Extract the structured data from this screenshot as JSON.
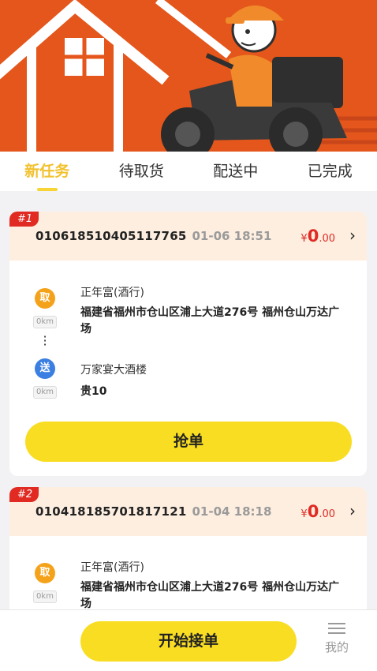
{
  "tabs": [
    "新任务",
    "待取货",
    "配送中",
    "已完成"
  ],
  "orders": [
    {
      "index": "#1",
      "order_no": "010618510405117765",
      "time": "01-06 18:51",
      "currency": "¥",
      "price_int": "0",
      "price_dec": ".00",
      "pickup": {
        "label": "取",
        "distance": "0km",
        "name": "正年富(酒行)",
        "addr_line1": "福建省福州市仓山区浦上大道276号 福州仓山万达广",
        "addr_line2": "场"
      },
      "dropoff": {
        "label": "送",
        "distance": "0km",
        "name": "万家宴大酒楼",
        "addr_line1": "贵10"
      },
      "button": "抢单"
    },
    {
      "index": "#2",
      "order_no": "010418185701817121",
      "time": "01-04 18:18",
      "currency": "¥",
      "price_int": "0",
      "price_dec": ".00",
      "pickup": {
        "label": "取",
        "distance": "0km",
        "name": "正年富(酒行)",
        "addr_line1": "福建省福州市仓山区浦上大道276号 福州仓山万达广",
        "addr_line2": "场"
      }
    }
  ],
  "bottom": {
    "start_button": "开始接单",
    "mine_label": "我的"
  },
  "colors": {
    "banner": "#e4561b",
    "accent_yellow": "#f9dd22",
    "active_tab": "#f2c12e",
    "price_red": "#e02a22",
    "take_pin": "#f5a21b",
    "send_pin": "#3b7fe2"
  },
  "icons": [
    "house-illustration",
    "courier-scooter-illustration",
    "chevron-right-icon",
    "menu-icon"
  ]
}
